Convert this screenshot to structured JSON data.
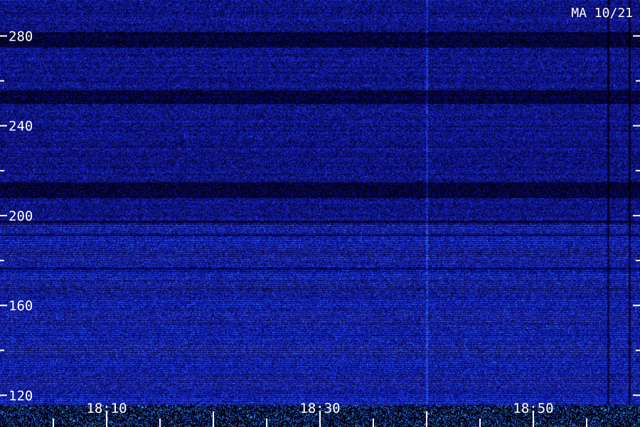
{
  "station_label": "MA 10/21",
  "chart_data": {
    "type": "heatmap",
    "title": "",
    "xlabel": "",
    "ylabel": "",
    "x_ticks_minutes": [
      "18:10",
      "18:30",
      "18:50"
    ],
    "xlim": [
      "18:00",
      "19:00"
    ],
    "x_minor_tick_step_minutes": 5,
    "y_ticks": [
      120,
      160,
      200,
      240,
      280
    ],
    "ylim": [
      116,
      296
    ],
    "y_minor_tick_step": 20,
    "colormap": [
      "#000010",
      "#0a0a6e",
      "#1a2ad0",
      "#2f6bff",
      "#3bd6e0"
    ],
    "grid": false,
    "features": {
      "horizontal_dark_bands": [
        [
          197,
          198
        ],
        [
          191,
          192
        ],
        [
          176,
          177
        ],
        [
          208,
          215
        ],
        [
          250,
          256
        ],
        [
          275,
          282
        ]
      ],
      "vertical_bright_line_time": "18:40",
      "vertical_dark_line_times": [
        "18:57",
        "18:59"
      ],
      "noisier_below_value": 196
    }
  }
}
